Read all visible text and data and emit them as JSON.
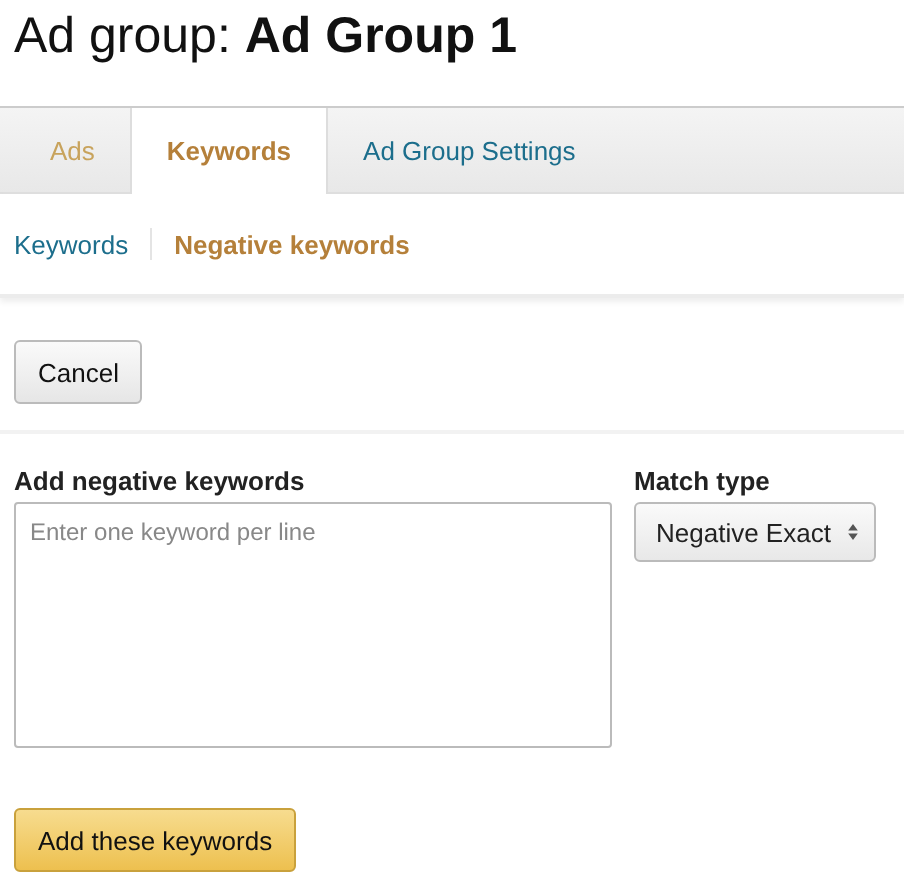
{
  "page_title": "Ad group: **Ad Group 1**",
  "tabs": [
    {
      "label": "Ads",
      "selected": false,
      "color": "#c8a35c"
    },
    {
      "label": "Keywords",
      "selected": true,
      "color": "#b5803a"
    },
    {
      "label": "Ad Group Settings",
      "selected": false,
      "color": "#1c6e8c"
    }
  ],
  "subtabs": [
    {
      "label": "Keywords",
      "selected": false
    },
    {
      "label": "Negative keywords",
      "selected": true
    }
  ],
  "cancel_button": "Cancel",
  "keywords_field": {
    "label": "Add negative keywords",
    "placeholder": "Enter one keyword per line"
  },
  "match_type": {
    "label": "Match type",
    "value": "Negative Exact"
  },
  "submit_button": "Add these keywords"
}
